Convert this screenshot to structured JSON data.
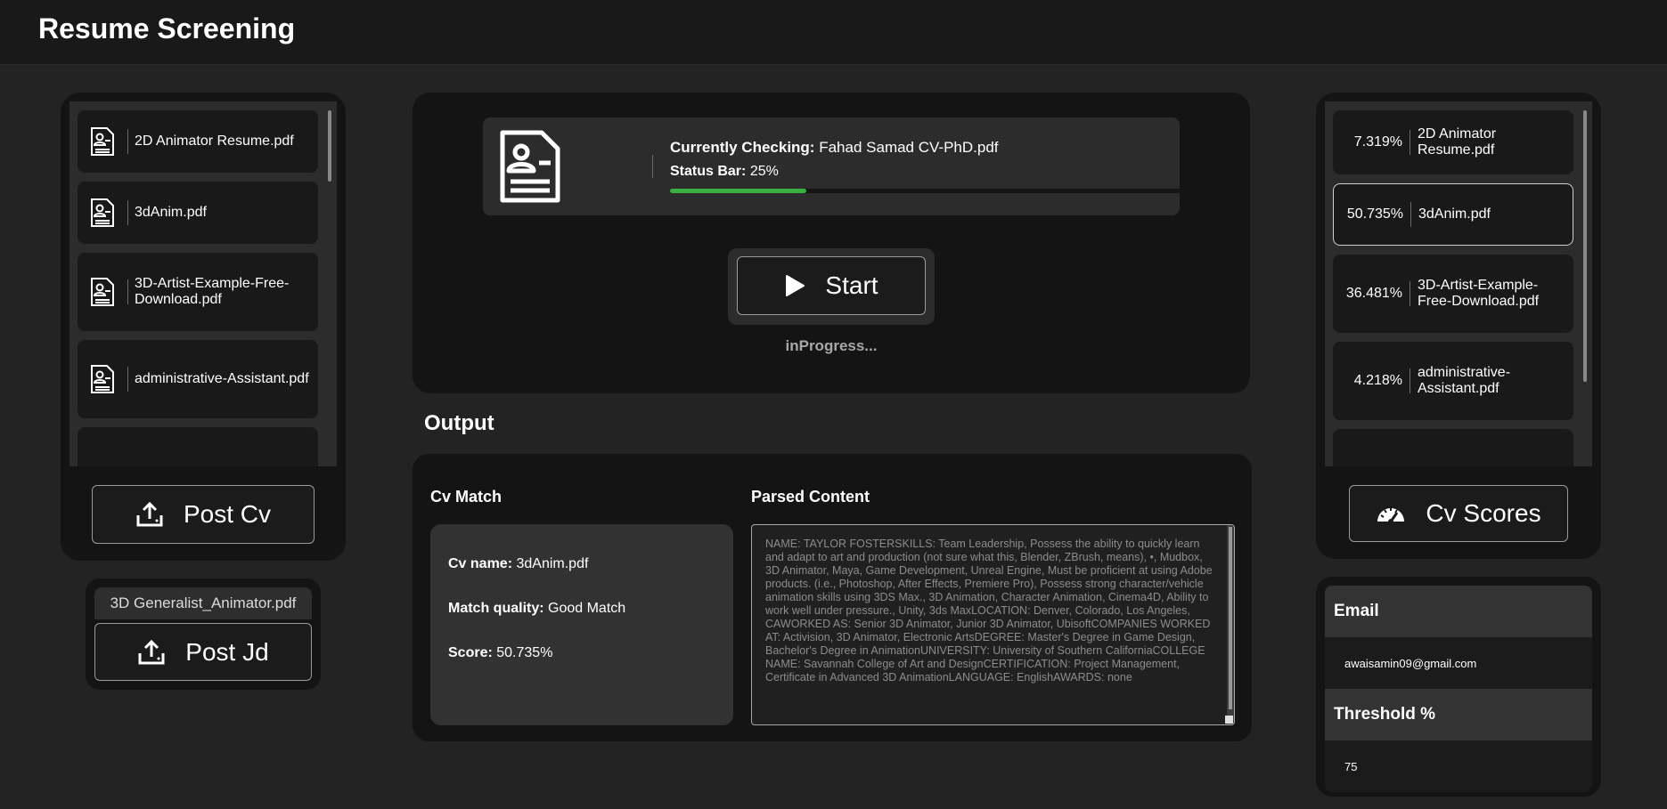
{
  "app": {
    "title": "Resume Screening"
  },
  "left_files": [
    "2D Animator Resume.pdf",
    "3dAnim.pdf",
    "3D-Artist-Example-Free-Download.pdf",
    "administrative-Assistant.pdf"
  ],
  "post_cv_label": "Post Cv",
  "jd": {
    "file_name": "3D Generalist_Animator.pdf",
    "post_label": "Post Jd"
  },
  "status": {
    "checking_label": "Currently Checking:",
    "checking_file": "Fahad Samad CV-PhD.pdf",
    "bar_label": "Status Bar:",
    "bar_value": "25%",
    "progress_fraction": 0.25,
    "progress_color": "#3ab03e"
  },
  "start_label": "Start",
  "state_text": "inProgress...",
  "output": {
    "title": "Output",
    "cv_match_title": "Cv Match",
    "parsed_title": "Parsed Content",
    "cv_name_label": "Cv name:",
    "cv_name": "3dAnim.pdf",
    "quality_label": "Match quality:",
    "quality": "Good Match",
    "score_label": "Score:",
    "score": "50.735%",
    "parsed_content": "NAME: TAYLOR FOSTERSKILLS: Team Leadership, Possess the ability to quickly learn and adapt to art and production (not sure what this, Blender, ZBrush, means), •, Mudbox, 3D Animator, Maya, Game Development, Unreal Engine, Must be proficient at using Adobe products. (i.e., Photoshop, After Effects, Premiere Pro), Possess strong character/vehicle animation skills using 3DS Max., 3D Animation, Character Animation, Cinema4D, Ability to work well under pressure., Unity, 3ds MaxLOCATION: Denver, Colorado, Los Angeles, CAWORKED AS: Senior 3D Animator, Junior 3D Animator, UbisoftCOMPANIES WORKED AT: Activision, 3D Animator, Electronic ArtsDEGREE: Master's Degree in Game Design, Bachelor's Degree in AnimationUNIVERSITY: University of Southern CaliforniaCOLLEGE NAME: Savannah College of Art and DesignCERTIFICATION: Project Management, Certificate in Advanced 3D AnimationLANGUAGE: EnglishAWARDS: none"
  },
  "scores": [
    {
      "pct": "7.319%",
      "name": "2D Animator Resume.pdf"
    },
    {
      "pct": "50.735%",
      "name": "3dAnim.pdf"
    },
    {
      "pct": "36.481%",
      "name": "3D-Artist-Example-Free-Download.pdf"
    },
    {
      "pct": "4.218%",
      "name": "administrative-Assistant.pdf"
    }
  ],
  "cv_scores_label": "Cv Scores",
  "settings": {
    "email_label": "Email",
    "email_value": "awaisamin09@gmail.com",
    "threshold_label": "Threshold %",
    "threshold_value": "75"
  }
}
